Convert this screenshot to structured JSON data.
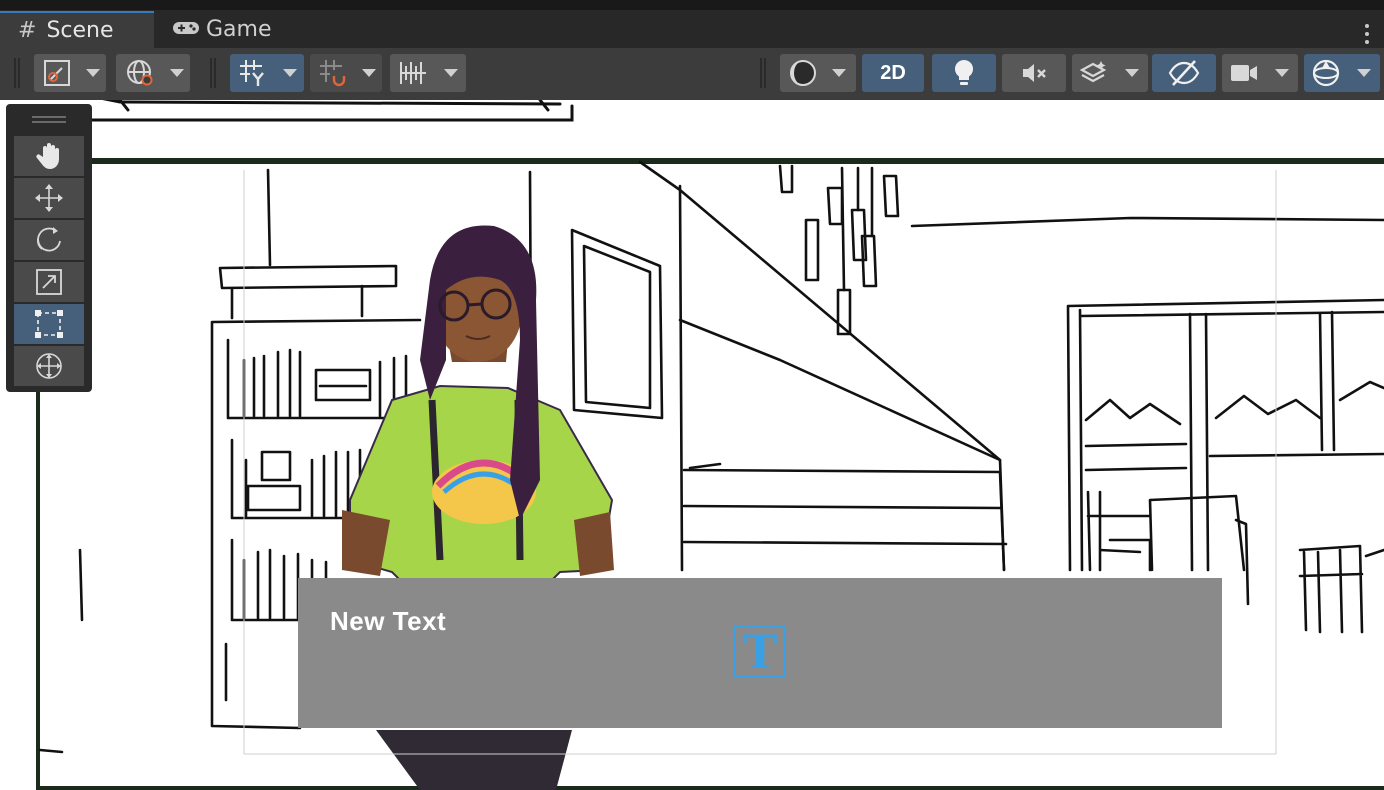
{
  "tabs": [
    {
      "label": "Scene",
      "icon": "hash-icon",
      "active": true
    },
    {
      "label": "Game",
      "icon": "gamepad-icon",
      "active": false
    }
  ],
  "toolbar": {
    "mode_2d_label": "2D",
    "accent_color": "#46607c"
  },
  "tools": [
    {
      "name": "hand-tool",
      "icon": "hand-icon",
      "active": false
    },
    {
      "name": "move-tool",
      "icon": "move-arrows-icon",
      "active": false
    },
    {
      "name": "rotate-tool",
      "icon": "rotate-icon",
      "active": false
    },
    {
      "name": "scale-tool",
      "icon": "scale-icon",
      "active": false
    },
    {
      "name": "rect-tool",
      "icon": "rect-transform-icon",
      "active": true
    },
    {
      "name": "transform-tool",
      "icon": "transform-icon",
      "active": false
    }
  ],
  "scene": {
    "dialog_text": "New Text",
    "text_gizmo": "T"
  }
}
